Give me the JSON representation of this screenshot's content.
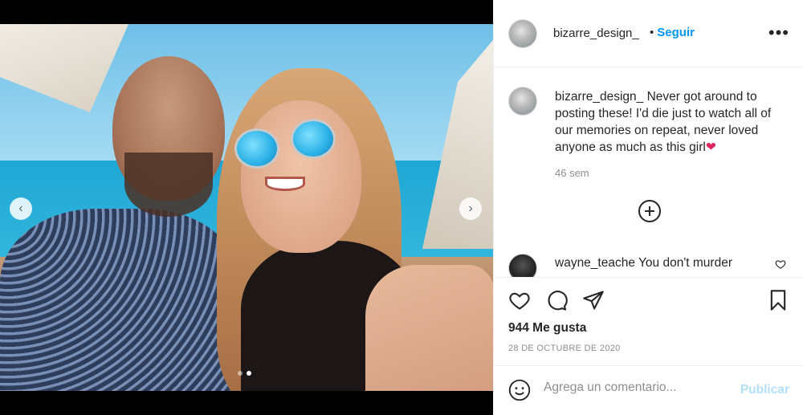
{
  "post": {
    "username": "bizarre_design_",
    "follow_bullet": "•",
    "follow_label": "Seguir",
    "more_label": "•••",
    "caption": "Never got around to posting these! I'd die just to watch all of our memories on repeat, never loved anyone as much as this girl",
    "caption_emoji": "❤",
    "time_ago": "46 sem",
    "likes": "944 Me gusta",
    "date": "28 DE OCTUBRE DE 2020"
  },
  "carousel": {
    "prev_glyph": "‹",
    "next_glyph": "›",
    "slide_count": 2,
    "active_slide": 2
  },
  "comments": [
    {
      "username": "wayne_teache",
      "text": "You don't murder"
    }
  ],
  "composer": {
    "placeholder": "Agrega un comentario...",
    "publish_label": "Publicar"
  },
  "icons": {
    "like": "heart-icon",
    "comment": "comment-bubble-icon",
    "share": "paper-plane-icon",
    "save": "bookmark-icon",
    "emoji": "emoji-smile-icon",
    "add": "plus-circle-icon"
  },
  "colors": {
    "link_blue": "#0095f6",
    "publish_disabled": "#b2dffc",
    "text_primary": "#262626",
    "text_secondary": "#8e8e8e"
  }
}
